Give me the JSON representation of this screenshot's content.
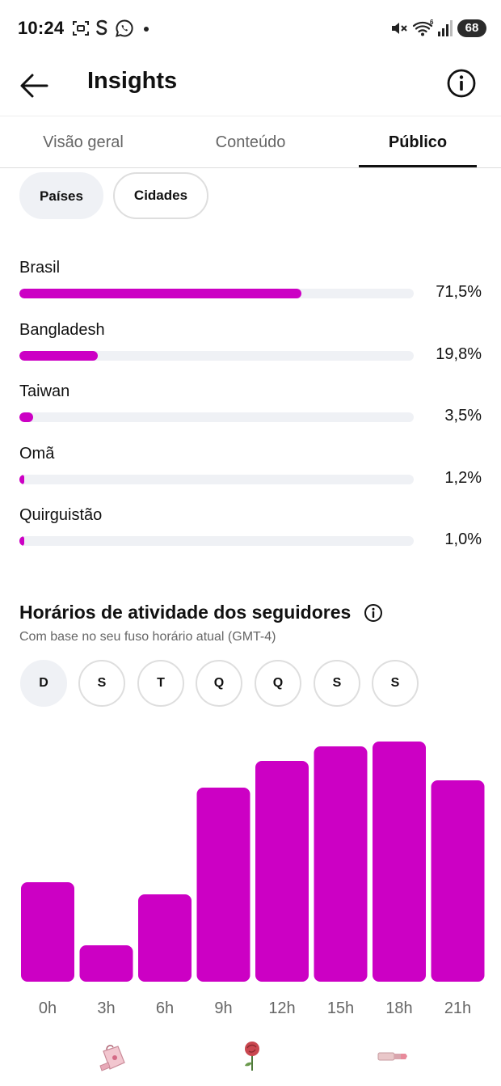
{
  "status_bar": {
    "time": "10:24",
    "battery": "68",
    "icons": [
      "screenshot-icon",
      "s-app-icon",
      "whatsapp-icon",
      "dot-icon",
      "mute-icon",
      "wifi-icon",
      "signal-icon",
      "battery-icon"
    ]
  },
  "header": {
    "title": "Insights",
    "back_icon": "arrow-left-icon",
    "info_icon": "info-icon"
  },
  "tabs": [
    {
      "label": "Visão geral",
      "active": false
    },
    {
      "label": "Conteúdo",
      "active": false
    },
    {
      "label": "Público",
      "active": true
    }
  ],
  "location_filter": {
    "chips": [
      {
        "label": "Países",
        "active": true
      },
      {
        "label": "Cidades",
        "active": false
      }
    ]
  },
  "countries": [
    {
      "name": "Brasil",
      "percent_label": "71,5%",
      "value": 71.5
    },
    {
      "name": "Bangladesh",
      "percent_label": "19,8%",
      "value": 19.8
    },
    {
      "name": "Taiwan",
      "percent_label": "3,5%",
      "value": 3.5
    },
    {
      "name": "Omã",
      "percent_label": "1,2%",
      "value": 1.2
    },
    {
      "name": "Quirguistão",
      "percent_label": "1,0%",
      "value": 1.0
    }
  ],
  "activity": {
    "title": "Horários de atividade dos seguidores",
    "subtitle": "Com base no seu fuso horário atual (GMT-4)",
    "days": [
      {
        "label": "D",
        "active": true
      },
      {
        "label": "S",
        "active": false
      },
      {
        "label": "T",
        "active": false
      },
      {
        "label": "Q",
        "active": false
      },
      {
        "label": "Q",
        "active": false
      },
      {
        "label": "S",
        "active": false
      },
      {
        "label": "S",
        "active": false
      }
    ]
  },
  "chart_data": {
    "type": "bar",
    "categories": [
      "0h",
      "3h",
      "6h",
      "9h",
      "12h",
      "15h",
      "18h",
      "21h"
    ],
    "values": [
      41,
      15,
      36,
      80,
      91,
      97,
      99,
      83
    ],
    "ylim": [
      0,
      100
    ],
    "bar_color": "#cc00c4",
    "grid": false
  },
  "colors": {
    "accent": "#cc00c4",
    "track": "#eff1f5",
    "chip_active": "#eff1f5"
  },
  "bottom_stickers": [
    "gift-bag-icon",
    "rose-icon",
    "lipstick-icon"
  ]
}
